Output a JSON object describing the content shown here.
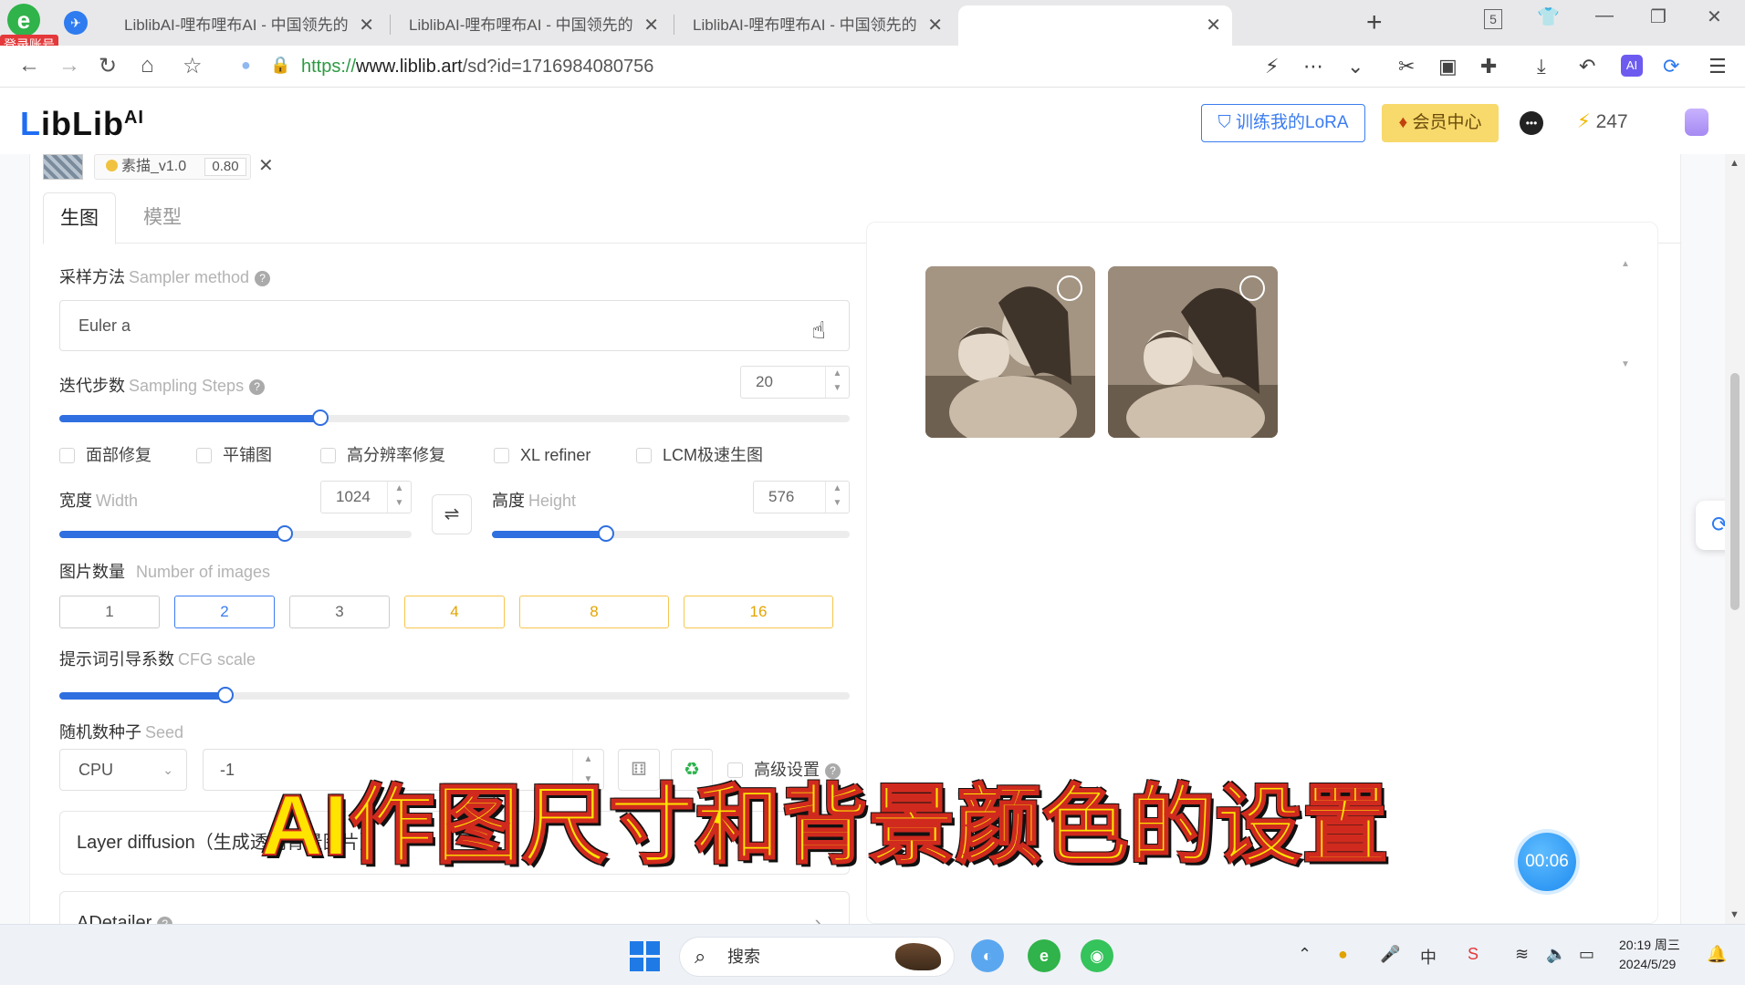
{
  "browser": {
    "login_badge": "登录账号",
    "tabs": [
      {
        "title": "LiblibAI-哩布哩布AI - 中国领先的"
      },
      {
        "title": "LiblibAI-哩布哩布AI - 中国领先的"
      },
      {
        "title": "LiblibAI-哩布哩布AI - 中国领先的"
      },
      {
        "title": ""
      }
    ],
    "tab_close": "✕",
    "new_tab": "+",
    "tab_count": "5",
    "url": {
      "scheme": "https://",
      "host": "www.liblib.art",
      "path": "/sd?id=1716984080756"
    }
  },
  "site": {
    "logo_mark": "L",
    "logo_text": "ibLib",
    "logo_sup": "AI",
    "train_lora": "训练我的LoRA",
    "vip_center": "会员中心",
    "credits": "247"
  },
  "lora": {
    "name": "素描_v1.0",
    "weight": "0.80",
    "close": "✕"
  },
  "tabs": {
    "generate": "生图",
    "model": "模型"
  },
  "sampler": {
    "label": "采样方法",
    "label_en": "Sampler method",
    "value": "Euler a"
  },
  "steps": {
    "label": "迭代步数",
    "label_en": "Sampling Steps",
    "value": "20",
    "slider_fraction": 0.33
  },
  "options": [
    {
      "label": "面部修复"
    },
    {
      "label": "平铺图"
    },
    {
      "label": "高分辨率修复"
    },
    {
      "label": "XL refiner"
    },
    {
      "label": "LCM极速生图"
    }
  ],
  "width": {
    "label": "宽度",
    "label_en": "Width",
    "value": "1024",
    "slider_fraction": 0.64
  },
  "height": {
    "label": "高度",
    "label_en": "Height",
    "value": "576",
    "slider_fraction": 0.32
  },
  "swap": "⇌",
  "images_count": {
    "label": "图片数量",
    "label_en": "Number of images",
    "options": [
      "1",
      "2",
      "3",
      "4",
      "8",
      "16"
    ],
    "selected": "2"
  },
  "cfg": {
    "label": "提示词引导系数",
    "label_en": "CFG scale",
    "slider_fraction": 0.21
  },
  "seed": {
    "label": "随机数种子",
    "label_en": "Seed",
    "device": "CPU",
    "value": "-1"
  },
  "advanced": {
    "label": "高级设置"
  },
  "sections": {
    "layer_diffusion": "Layer diffusion（生成透明背景图片）",
    "adetailer": "ADetailer"
  },
  "timer": "00:06",
  "caption": "AI作图尺寸和背景颜色的设置",
  "taskbar": {
    "search": "搜索",
    "time": "20:19 周三",
    "date": "2024/5/29",
    "ime": "中"
  },
  "colors": {
    "accent": "#2f6fe0",
    "vip": "#f7d96c",
    "caption": "#ffe400"
  }
}
